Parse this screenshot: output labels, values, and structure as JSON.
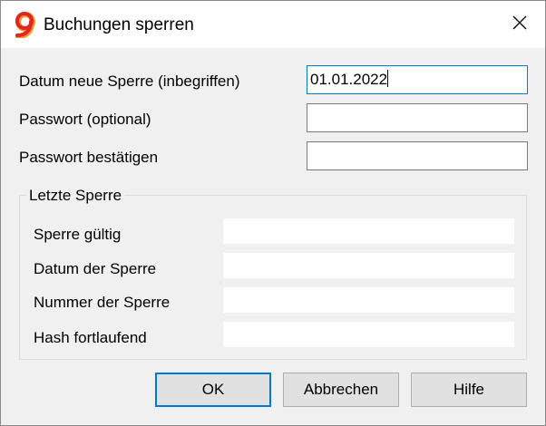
{
  "window": {
    "title": "Buchungen sperren",
    "close_icon": "close-icon",
    "app_icon": "banana-9-logo"
  },
  "form": {
    "date_label": "Datum neue Sperre (inbegriffen)",
    "date_value": "01.01.2022",
    "password_label": "Passwort (optional)",
    "password_value": "",
    "confirm_label": "Passwort bestätigen",
    "confirm_value": ""
  },
  "last_lock": {
    "title": "Letzte Sperre",
    "fields": [
      {
        "label": "Sperre gültig",
        "value": ""
      },
      {
        "label": "Datum der Sperre",
        "value": ""
      },
      {
        "label": "Nummer der Sperre",
        "value": ""
      },
      {
        "label": "Hash fortlaufend",
        "value": ""
      }
    ]
  },
  "buttons": {
    "ok": "OK",
    "cancel": "Abbrechen",
    "help": "Hilfe"
  },
  "colors": {
    "focus": "#0078d7",
    "logo_red": "#e0242b",
    "logo_orange": "#f39a1e"
  }
}
